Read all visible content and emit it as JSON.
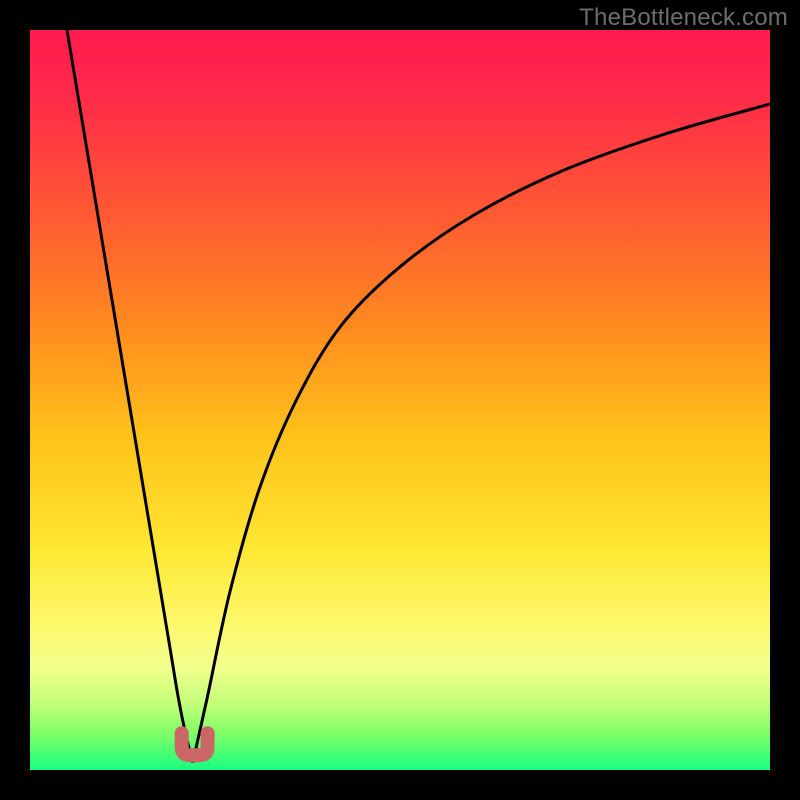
{
  "watermark": "TheBottleneck.com",
  "chart_data": {
    "type": "line",
    "title": "",
    "xlabel": "",
    "ylabel": "",
    "xlim": [
      0,
      100
    ],
    "ylim": [
      0,
      100
    ],
    "grid": false,
    "legend": false,
    "notes": "Bottleneck-percentage curve. No axis ticks or numeric labels visible. Colored background gradient encodes severity: green (low, y≈0) through yellow/orange to red (high, y≈100). A black V-shaped curve has its minimum near x≈22, y≈0 and rises steeply to y≈100 on the left edge and asymptotically toward ~90 on the right. A small salmon U-shaped marker highlights the minimum region near x≈21–24.",
    "series": [
      {
        "name": "left-branch",
        "x": [
          5,
          8,
          11,
          14,
          17,
          19,
          20,
          21,
          22
        ],
        "y": [
          100,
          82,
          64,
          46,
          28,
          16,
          10,
          5,
          1
        ]
      },
      {
        "name": "right-branch",
        "x": [
          22,
          24,
          27,
          31,
          36,
          42,
          50,
          60,
          72,
          86,
          100
        ],
        "y": [
          1,
          10,
          24,
          38,
          50,
          60,
          68,
          75,
          81,
          86,
          90
        ]
      }
    ],
    "marker": {
      "name": "min-region",
      "color": "#cc6666",
      "x_range": [
        20.5,
        24
      ],
      "y": 2
    },
    "background_gradient_stops": [
      {
        "pos": 0.0,
        "color": "#ff1a52"
      },
      {
        "pos": 0.1,
        "color": "#ff2d47"
      },
      {
        "pos": 0.25,
        "color": "#ff5a33"
      },
      {
        "pos": 0.4,
        "color": "#ff8a1f"
      },
      {
        "pos": 0.55,
        "color": "#ffc21a"
      },
      {
        "pos": 0.7,
        "color": "#ffe733"
      },
      {
        "pos": 0.8,
        "color": "#fdf86a"
      },
      {
        "pos": 0.86,
        "color": "#f3ff8c"
      },
      {
        "pos": 0.91,
        "color": "#c4ff7a"
      },
      {
        "pos": 0.95,
        "color": "#7fff66"
      },
      {
        "pos": 1.0,
        "color": "#1aff80"
      }
    ]
  }
}
